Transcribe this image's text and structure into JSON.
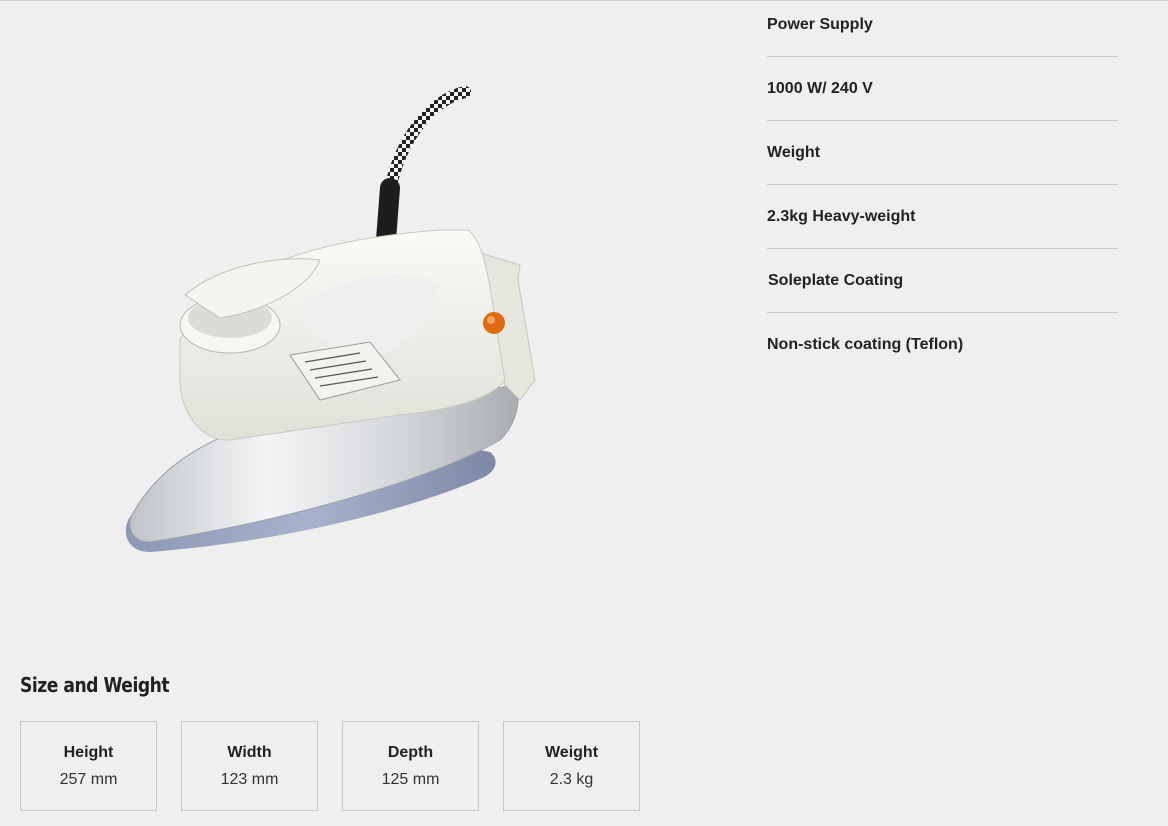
{
  "product": {
    "image_icon": "steam-iron-product-photo"
  },
  "specs": [
    {
      "text": "Power Supply"
    },
    {
      "text": "1000 W/ 240 V"
    },
    {
      "text": "Weight"
    },
    {
      "text": "2.3kg Heavy-weight"
    },
    {
      "text": "Soleplate Coating"
    },
    {
      "text": "Non-stick coating (Teflon)"
    }
  ],
  "size_section": {
    "title": "Size and Weight",
    "items": [
      {
        "label": "Height",
        "value": "257 mm"
      },
      {
        "label": "Width",
        "value": "123 mm"
      },
      {
        "label": "Depth",
        "value": "125 mm"
      },
      {
        "label": "Weight",
        "value": "2.3 kg"
      }
    ]
  },
  "colors": {
    "background": "#efefef",
    "text": "#222222",
    "divider": "#c9c9c9",
    "accent_dot": "#e06a10"
  }
}
